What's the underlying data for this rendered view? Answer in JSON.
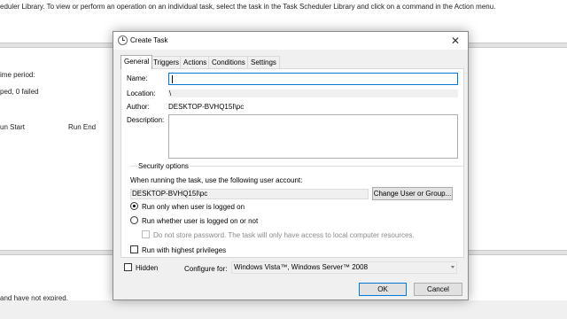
{
  "background": {
    "intro": "eduler Library. To view or perform an operation on an individual task, select the task in the Task Scheduler Library and click on a command in the Action menu.",
    "time_period": "ime period:",
    "status_line": "ped, 0 failed",
    "col_run_start": "un Start",
    "col_run_end": "Run End",
    "footer_text": "and have not expired."
  },
  "dialog": {
    "title": "Create Task",
    "close_glyph": "✕",
    "tabs": [
      {
        "label": "General",
        "active": true
      },
      {
        "label": "Triggers",
        "active": false
      },
      {
        "label": "Actions",
        "active": false
      },
      {
        "label": "Conditions",
        "active": false
      },
      {
        "label": "Settings",
        "active": false
      }
    ],
    "general": {
      "name_label": "Name:",
      "name_value": "",
      "location_label": "Location:",
      "location_value": "\\",
      "author_label": "Author:",
      "author_value": "DESKTOP-BVHQ15I\\pc",
      "description_label": "Description:",
      "description_value": "",
      "security": {
        "title": "Security options",
        "account_prompt": "When running the task, use the following user account:",
        "account_value": "DESKTOP-BVHQ15I\\pc",
        "change_button": "Change User or Group...",
        "radio_logged_on": "Run only when user is logged on",
        "radio_logged_on_selected": true,
        "radio_whether": "Run whether user is logged on or not",
        "no_store_password": "Do not store password.  The task will only have access to local computer resources.",
        "highest_privileges": "Run with highest privileges"
      }
    },
    "hidden_label": "Hidden",
    "configure_label": "Configure for:",
    "configure_value": "Windows Vista™, Windows Server™ 2008",
    "ok_button": "OK",
    "cancel_button": "Cancel"
  },
  "colors": {
    "accent": "#0078d7",
    "dialog_bg": "#f0f0f0",
    "panel_bg": "#ffffff",
    "disabled_text": "#8a8a8a"
  }
}
